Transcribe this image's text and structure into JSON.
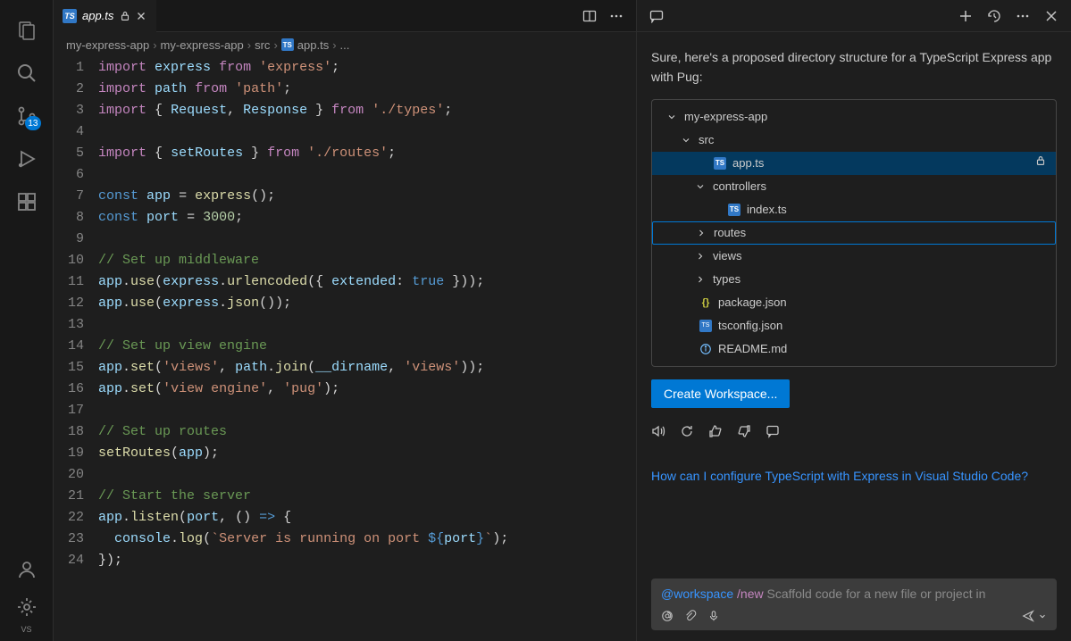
{
  "activityBar": {
    "badge": "13",
    "vsLabel": "VS"
  },
  "tab": {
    "iconText": "TS",
    "filename": "app.ts"
  },
  "breadcrumb": {
    "items": [
      "my-express-app",
      "my-express-app",
      "src",
      "app.ts"
    ],
    "iconText": "TS",
    "trail": "..."
  },
  "editor": {
    "lines": [
      {
        "n": 1,
        "html": "<span class='tok-kw'>import</span> <span class='tok-var'>express</span> <span class='tok-kw'>from</span> <span class='tok-str'>'express'</span><span class='tok-punc'>;</span>"
      },
      {
        "n": 2,
        "html": "<span class='tok-kw'>import</span> <span class='tok-var'>path</span> <span class='tok-kw'>from</span> <span class='tok-str'>'path'</span><span class='tok-punc'>;</span>"
      },
      {
        "n": 3,
        "html": "<span class='tok-kw'>import</span> <span class='tok-punc'>{</span> <span class='tok-var'>Request</span><span class='tok-punc'>,</span> <span class='tok-var'>Response</span> <span class='tok-punc'>}</span> <span class='tok-kw'>from</span> <span class='tok-str'>'./types'</span><span class='tok-punc'>;</span>"
      },
      {
        "n": 4,
        "html": ""
      },
      {
        "n": 5,
        "html": "<span class='tok-kw'>import</span> <span class='tok-punc'>{</span> <span class='tok-var'>setRoutes</span> <span class='tok-punc'>}</span> <span class='tok-kw'>from</span> <span class='tok-str'>'./routes'</span><span class='tok-punc'>;</span>"
      },
      {
        "n": 6,
        "html": ""
      },
      {
        "n": 7,
        "html": "<span class='tok-const'>const</span> <span class='tok-var'>app</span> <span class='tok-punc'>=</span> <span class='tok-fn'>express</span><span class='tok-punc'>();</span>"
      },
      {
        "n": 8,
        "html": "<span class='tok-const'>const</span> <span class='tok-var'>port</span> <span class='tok-punc'>=</span> <span class='tok-num'>3000</span><span class='tok-punc'>;</span>"
      },
      {
        "n": 9,
        "html": ""
      },
      {
        "n": 10,
        "html": "<span class='tok-comment'>// Set up middleware</span>"
      },
      {
        "n": 11,
        "html": "<span class='tok-var'>app</span><span class='tok-punc'>.</span><span class='tok-fn'>use</span><span class='tok-punc'>(</span><span class='tok-var'>express</span><span class='tok-punc'>.</span><span class='tok-fn'>urlencoded</span><span class='tok-punc'>({</span> <span class='tok-var'>extended</span><span class='tok-punc'>:</span> <span class='tok-const'>true</span> <span class='tok-punc'>}));</span>"
      },
      {
        "n": 12,
        "html": "<span class='tok-var'>app</span><span class='tok-punc'>.</span><span class='tok-fn'>use</span><span class='tok-punc'>(</span><span class='tok-var'>express</span><span class='tok-punc'>.</span><span class='tok-fn'>json</span><span class='tok-punc'>());</span>"
      },
      {
        "n": 13,
        "html": ""
      },
      {
        "n": 14,
        "html": "<span class='tok-comment'>// Set up view engine</span>"
      },
      {
        "n": 15,
        "html": "<span class='tok-var'>app</span><span class='tok-punc'>.</span><span class='tok-fn'>set</span><span class='tok-punc'>(</span><span class='tok-str'>'views'</span><span class='tok-punc'>,</span> <span class='tok-var'>path</span><span class='tok-punc'>.</span><span class='tok-fn'>join</span><span class='tok-punc'>(</span><span class='tok-var'>__dirname</span><span class='tok-punc'>,</span> <span class='tok-str'>'views'</span><span class='tok-punc'>));</span>"
      },
      {
        "n": 16,
        "html": "<span class='tok-var'>app</span><span class='tok-punc'>.</span><span class='tok-fn'>set</span><span class='tok-punc'>(</span><span class='tok-str'>'view engine'</span><span class='tok-punc'>,</span> <span class='tok-str'>'pug'</span><span class='tok-punc'>);</span>"
      },
      {
        "n": 17,
        "html": ""
      },
      {
        "n": 18,
        "html": "<span class='tok-comment'>// Set up routes</span>"
      },
      {
        "n": 19,
        "html": "<span class='tok-fn'>setRoutes</span><span class='tok-punc'>(</span><span class='tok-var'>app</span><span class='tok-punc'>);</span>"
      },
      {
        "n": 20,
        "html": ""
      },
      {
        "n": 21,
        "html": "<span class='tok-comment'>// Start the server</span>"
      },
      {
        "n": 22,
        "html": "<span class='tok-var'>app</span><span class='tok-punc'>.</span><span class='tok-fn'>listen</span><span class='tok-punc'>(</span><span class='tok-var'>port</span><span class='tok-punc'>,</span> <span class='tok-punc'>() </span><span class='tok-const'>=&gt;</span><span class='tok-punc'> {</span>"
      },
      {
        "n": 23,
        "html": "  <span class='tok-var'>console</span><span class='tok-punc'>.</span><span class='tok-fn'>log</span><span class='tok-punc'>(</span><span class='tok-str'>`Server is running on port </span><span class='tok-templ'>${</span><span class='tok-var'>port</span><span class='tok-templ'>}</span><span class='tok-str'>`</span><span class='tok-punc'>);</span>"
      },
      {
        "n": 24,
        "html": "<span class='tok-punc'>});</span>"
      }
    ]
  },
  "chat": {
    "message": "Sure, here's a proposed directory structure for a TypeScript Express app with Pug:",
    "tree": [
      {
        "depth": 0,
        "chevron": "down",
        "icon": "",
        "label": "my-express-app"
      },
      {
        "depth": 1,
        "chevron": "down",
        "icon": "",
        "label": "src"
      },
      {
        "depth": 2,
        "chevron": "",
        "icon": "ts",
        "label": "app.ts",
        "selected": true,
        "locked": true
      },
      {
        "depth": 2,
        "chevron": "down",
        "icon": "",
        "label": "controllers"
      },
      {
        "depth": 3,
        "chevron": "",
        "icon": "ts",
        "label": "index.ts"
      },
      {
        "depth": 2,
        "chevron": "right",
        "icon": "",
        "label": "routes",
        "outlined": true
      },
      {
        "depth": 2,
        "chevron": "right",
        "icon": "",
        "label": "views"
      },
      {
        "depth": 2,
        "chevron": "right",
        "icon": "",
        "label": "types"
      },
      {
        "depth": 1,
        "chevron": "",
        "icon": "json",
        "label": "package.json"
      },
      {
        "depth": 1,
        "chevron": "",
        "icon": "tsconf",
        "label": "tsconfig.json"
      },
      {
        "depth": 1,
        "chevron": "",
        "icon": "info",
        "label": "README.md"
      }
    ],
    "createButton": "Create Workspace...",
    "relatedLink": "How can I configure TypeScript with Express in Visual Studio Code?",
    "input": {
      "mention": "@workspace",
      "slash": "/new",
      "rest": " Scaffold code for a new file or project in"
    }
  }
}
